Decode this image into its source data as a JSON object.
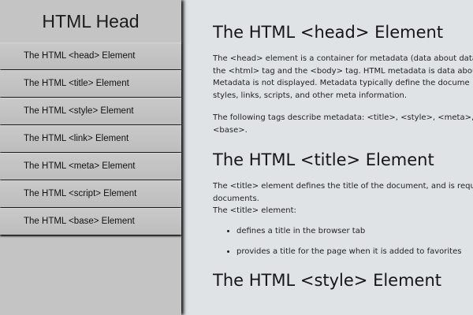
{
  "sidebar": {
    "title": "HTML Head",
    "items": [
      {
        "label": "The HTML <head> Element"
      },
      {
        "label": "The HTML <title> Element"
      },
      {
        "label": "The HTML <style> Element"
      },
      {
        "label": "The HTML <link> Element"
      },
      {
        "label": "The HTML <meta> Element"
      },
      {
        "label": "The HTML <script> Element"
      },
      {
        "label": "The HTML <base> Element"
      }
    ]
  },
  "main": {
    "head": {
      "heading": "The HTML <head> Element",
      "p1_lines": [
        "The <head> element is a container for metadata (data about data",
        "the <html> tag and the <body> tag. HTML metadata is data abou",
        "Metadata is not displayed. Metadata typically define the docume",
        "styles, links, scripts, and other meta information."
      ],
      "p2_lines": [
        "The following tags describe metadata: <title>, <style>, <meta>, <",
        "<base>."
      ]
    },
    "title": {
      "heading": "The HTML <title> Element",
      "p1_lines": [
        "The <title> element defines the title of the document, and is requ",
        "documents.",
        "The <title> element:"
      ],
      "list": [
        "defines a title in the browser tab",
        "provides a title for the page when it is added to favorites"
      ]
    },
    "style": {
      "heading": "The HTML <style> Element"
    }
  }
}
